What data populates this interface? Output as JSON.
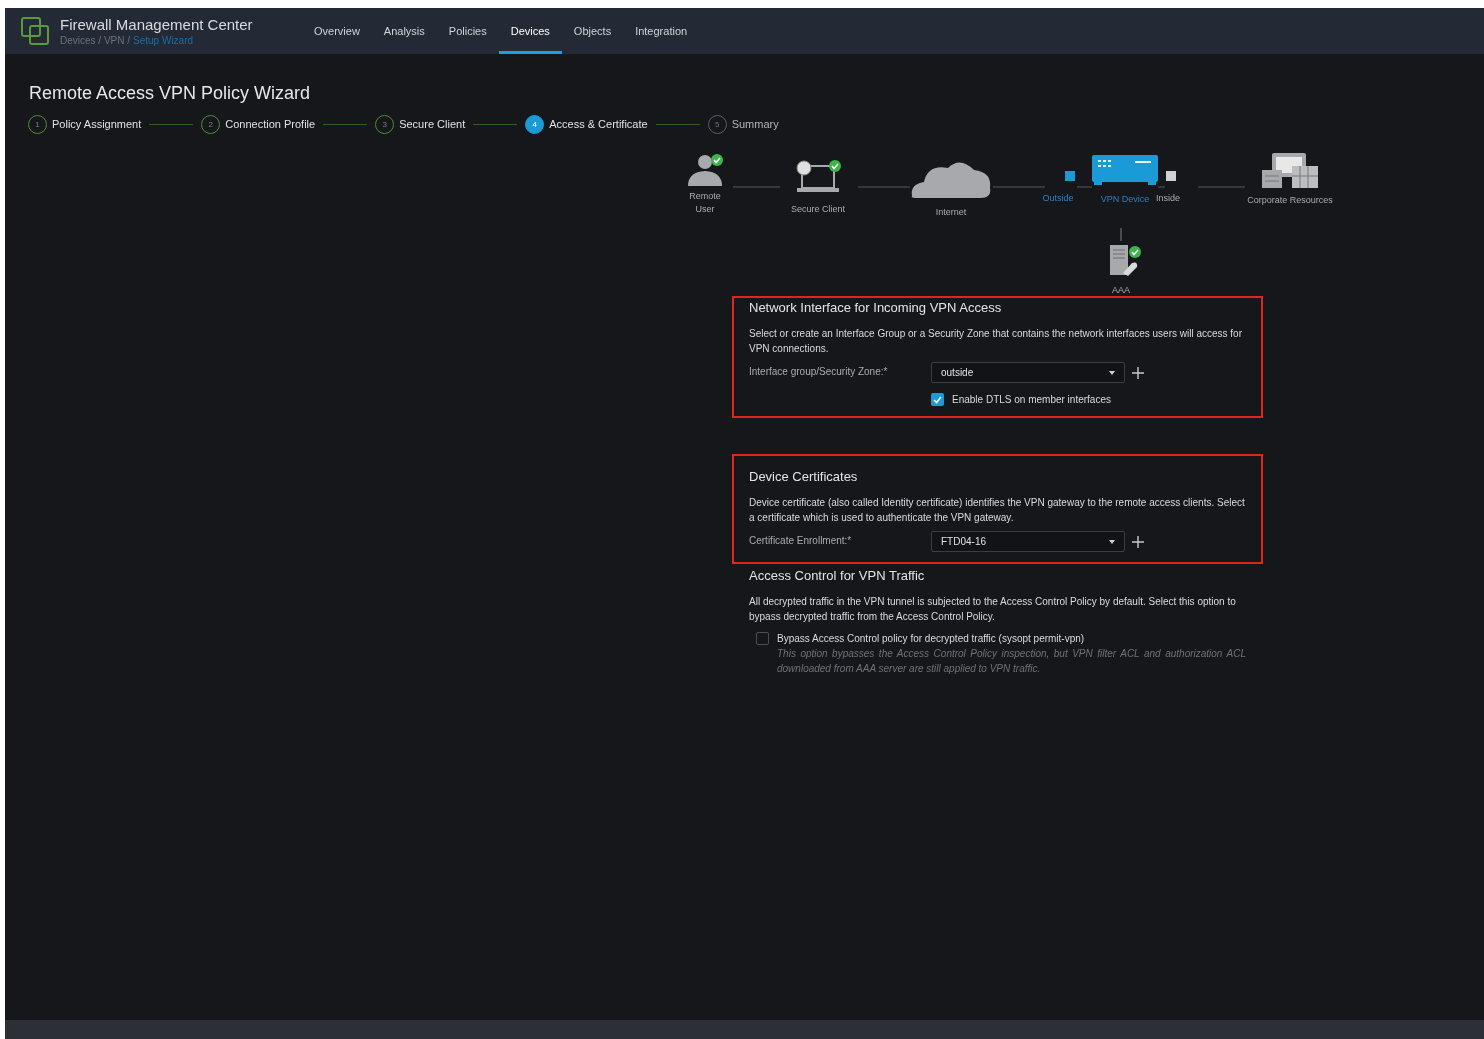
{
  "app": {
    "title": "Firewall Management Center",
    "breadcrumb": "Devices / VPN /",
    "breadcrumb_current": "Setup Wizard"
  },
  "nav": [
    {
      "label": "Overview",
      "selected": false
    },
    {
      "label": "Analysis",
      "selected": false
    },
    {
      "label": "Policies",
      "selected": false
    },
    {
      "label": "Devices",
      "selected": true
    },
    {
      "label": "Objects",
      "selected": false
    },
    {
      "label": "Integration",
      "selected": false
    }
  ],
  "page_title": "Remote Access VPN Policy Wizard",
  "steps": [
    {
      "number": "1",
      "label": "Policy Assignment",
      "completed": true,
      "selected": false
    },
    {
      "number": "2",
      "label": "Connection Profile",
      "completed": true,
      "selected": false
    },
    {
      "number": "3",
      "label": "Secure Client",
      "completed": true,
      "selected": false
    },
    {
      "number": "4",
      "label": "Access & Certificate",
      "completed": false,
      "selected": true
    },
    {
      "number": "5",
      "label": "Summary",
      "completed": false,
      "selected": false
    }
  ],
  "diagram": {
    "nodes": [
      {
        "kind": "user",
        "label": "Remote User",
        "verified": true
      },
      {
        "kind": "client",
        "label": "Secure Client",
        "verified": true
      },
      {
        "kind": "cloud",
        "label": "Internet",
        "verified": false
      },
      {
        "kind": "device",
        "label": "VPN Device",
        "verified": false,
        "ports": [
          "Outside",
          "Inside"
        ]
      },
      {
        "kind": "corporate",
        "label": "Corporate Resources",
        "verified": false
      },
      {
        "kind": "server",
        "label": "AAA",
        "verified": true
      }
    ]
  },
  "sections": [
    {
      "title": "Network Interface for Incoming VPN Access",
      "highlighted": true,
      "description": "Select or create an Interface Group or a Security Zone that contains the network interfaces users will access for VPN connections.",
      "fields": [
        {
          "kind": "select",
          "label": "Interface group/Security Zone:*",
          "value": "outside"
        },
        {
          "kind": "checkbox",
          "label": "Enable DTLS on member interfaces",
          "checked": true
        }
      ]
    },
    {
      "title": "Device Certificates",
      "highlighted": true,
      "description": "Device certificate (also called Identity certificate) identifies the VPN gateway to the remote access clients. Select a certificate which is used to authenticate the VPN gateway.",
      "fields": [
        {
          "kind": "select",
          "label": "Certificate Enrollment:*",
          "value": "FTD04-16"
        }
      ]
    },
    {
      "title": "Access Control for VPN Traffic",
      "highlighted": false,
      "description": "All decrypted traffic in the VPN tunnel is subjected to the Access Control Policy by default. Select this option to bypass decrypted traffic from the Access Control Policy.",
      "fields": [
        {
          "kind": "option",
          "label": "Bypass Access Control policy for decrypted traffic (sysopt permit-vpn)",
          "checked": false,
          "note": "This option bypasses the Access Control Policy inspection, but VPN filter ACL and authorization ACL downloaded from AAA server are still applied to VPN traffic."
        }
      ]
    }
  ]
}
